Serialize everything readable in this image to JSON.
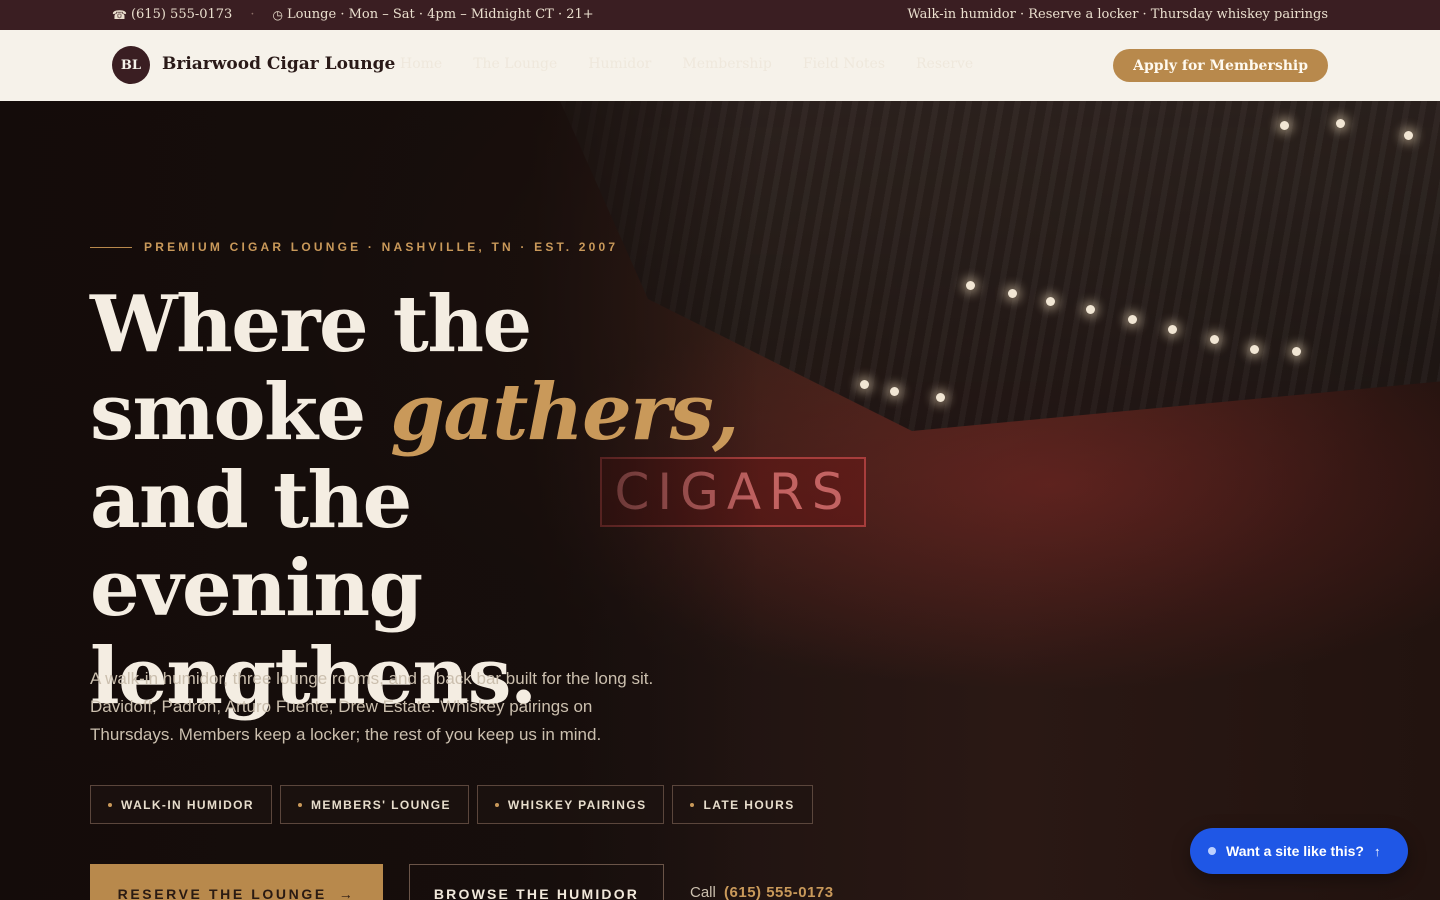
{
  "topbar": {
    "phone": "(615) 555-0173",
    "hours": "Lounge · Mon – Sat · 4pm – Midnight CT · 21+",
    "right_text": "Walk-in humidor · Reserve a locker · Thursday whiskey pairings"
  },
  "header": {
    "logo_initials": "BL",
    "brand": "Briarwood Cigar Lounge",
    "nav": [
      "Home",
      "The Lounge",
      "Humidor",
      "Membership",
      "Field Notes",
      "Reserve"
    ],
    "apply_label": "Apply for Membership"
  },
  "hero": {
    "eyebrow": "PREMIUM CIGAR LOUNGE · NASHVILLE, TN · EST. 2007",
    "headline_1": "Where the",
    "headline_2a": "smoke ",
    "headline_2b": "gathers,",
    "headline_3": "and the evening",
    "headline_4": "lengthens.",
    "lede": "A walk-in humidor, three lounge rooms, and a back bar built for the long sit. Davidoff, Padrón, Arturo Fuente, Drew Estate. Whiskey pairings on Thursdays. Members keep a locker; the rest of you keep us in mind.",
    "pills": [
      "WALK-IN HUMIDOR",
      "MEMBERS' LOUNGE",
      "WHISKEY PAIRINGS",
      "LATE HOURS"
    ],
    "primary_cta": "RESERVE THE LOUNGE",
    "secondary_cta": "BROWSE THE HUMIDOR",
    "call_label": "Call",
    "call_number": "(615) 555-0173",
    "neon_sign": "CIGARS"
  },
  "widget": {
    "label": "Want a site like this?"
  },
  "colors": {
    "accent": "#b8894c",
    "topbar": "#3a1e22",
    "header_bg": "#f6f2ea",
    "widget": "#1f57e6"
  }
}
